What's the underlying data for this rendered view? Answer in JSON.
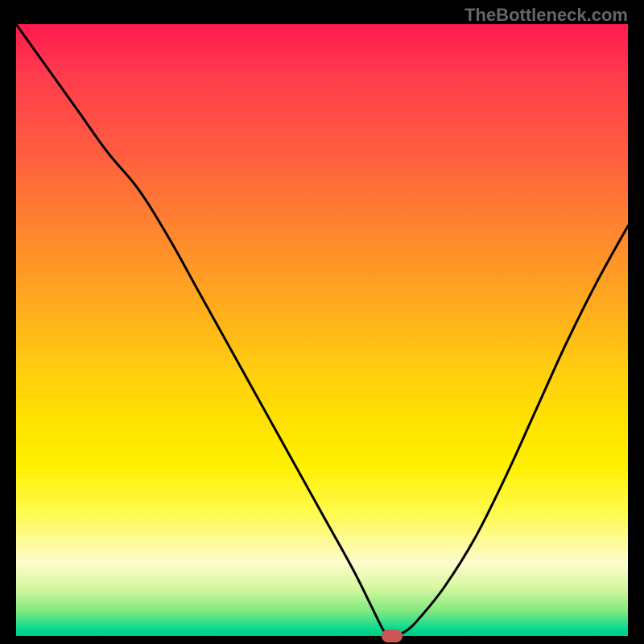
{
  "watermark": "TheBottleneck.com",
  "chart_data": {
    "type": "line",
    "title": "",
    "xlabel": "",
    "ylabel": "",
    "xlim": [
      0,
      100
    ],
    "ylim": [
      0,
      100
    ],
    "series": [
      {
        "name": "bottleneck-curve",
        "x": [
          0,
          5,
          10,
          15,
          20,
          25,
          30,
          35,
          40,
          45,
          50,
          55,
          58,
          60,
          61,
          62,
          64,
          66,
          70,
          75,
          80,
          85,
          90,
          95,
          100
        ],
        "values": [
          100,
          93,
          86,
          79,
          73,
          65,
          56,
          47,
          38,
          29,
          20,
          11,
          5,
          1,
          0,
          0,
          1,
          3,
          8,
          16,
          26,
          37,
          48,
          58,
          67
        ]
      }
    ],
    "marker": {
      "x": 61.5,
      "y": 0,
      "color": "#cc5555"
    },
    "gradient_stops": [
      {
        "pos": 0,
        "color": "#ff1a4d"
      },
      {
        "pos": 50,
        "color": "#ffc000"
      },
      {
        "pos": 80,
        "color": "#fff000"
      },
      {
        "pos": 100,
        "color": "#00cc80"
      }
    ]
  }
}
